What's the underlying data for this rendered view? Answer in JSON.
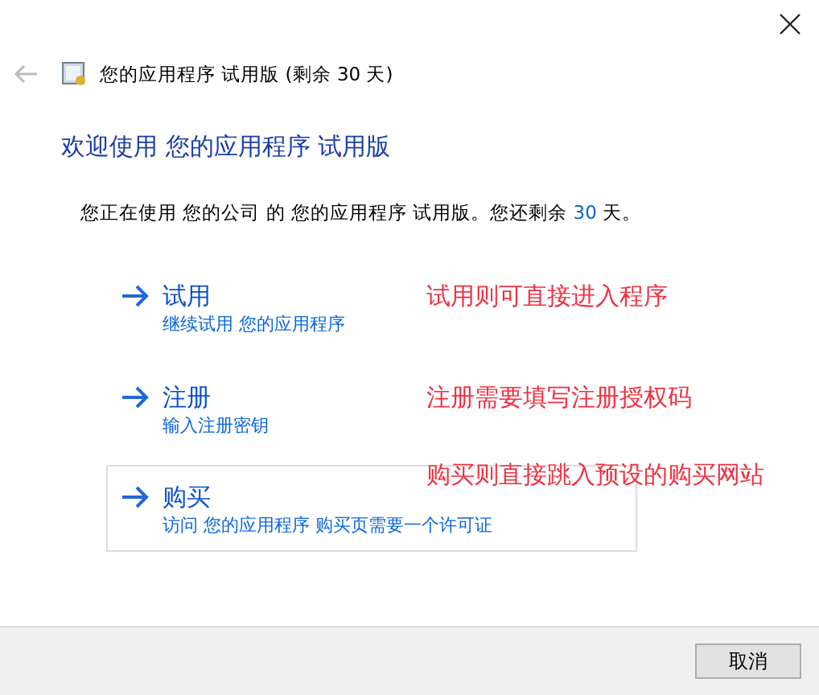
{
  "window": {
    "title": "您的应用程序 试用版 (剩余 30 天)"
  },
  "heading": "欢迎使用 您的应用程序 试用版",
  "message": "您正在使用 您的公司 的 您的应用程序 试用版。您还剩余 **30** 天。",
  "options": [
    {
      "label": "试用",
      "description": "继续试用 您的应用程序",
      "highlighted": false,
      "annotation": "试用则可直接进入程序"
    },
    {
      "label": "注册",
      "description": "输入注册密钥",
      "highlighted": false,
      "annotation": "注册需要填写注册授权码"
    },
    {
      "label": "购买",
      "description": "访问 您的应用程序 购买页需要一个许可证",
      "highlighted": true,
      "annotation": "购买则直接跳入预设的购买网站"
    }
  ],
  "buttons": [
    "取消"
  ]
}
